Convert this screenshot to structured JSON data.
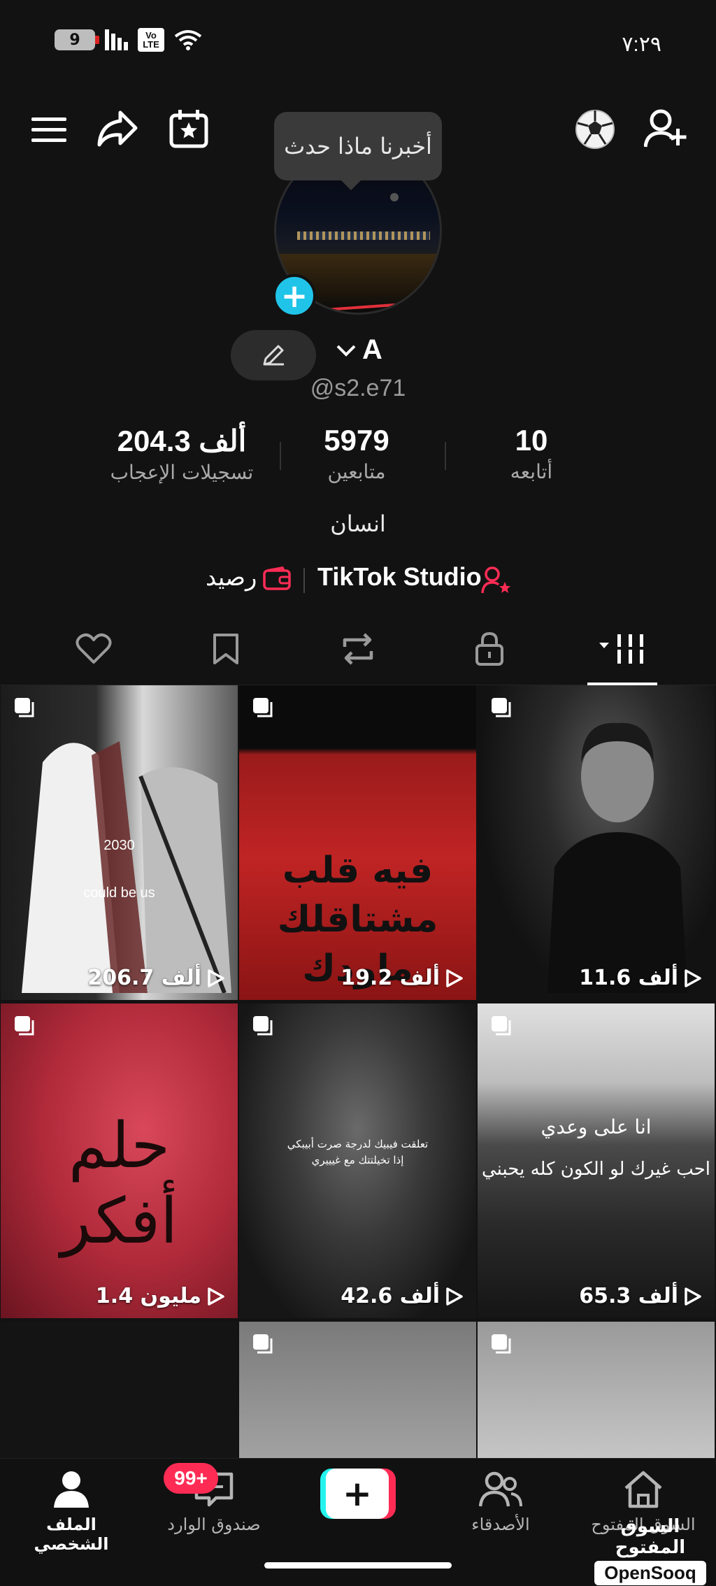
{
  "status_bar": {
    "battery_level": "9",
    "network_label": "Vo LTE",
    "time": "٧:٢٩"
  },
  "tooltip": {
    "text": "أخبرنا ماذا حدث"
  },
  "profile": {
    "display_name": "A",
    "username": "@s2.e71",
    "bio": "انسان"
  },
  "stats": {
    "following": {
      "value": "10",
      "label": "أتابعه"
    },
    "followers": {
      "value": "5979",
      "label": "متابعين"
    },
    "likes": {
      "value": "204.3 ألف",
      "label": "تسجيلات الإعجاب"
    }
  },
  "links": {
    "studio": "TikTok Studio",
    "wallet": "رصيد"
  },
  "videos": [
    {
      "views": "11.6 ألف"
    },
    {
      "views": "19.2 ألف",
      "text": "فيه قلب مشتاقلك ماودك تحره؟"
    },
    {
      "views": "206.7 ألف",
      "text1": "2030",
      "text2": "could be us"
    },
    {
      "views": "65.3 ألف",
      "text1": "انا على وعدي",
      "text2": "احب غيرك لو الكون كله يحبني"
    },
    {
      "views": "42.6 ألف",
      "text": "تعلقت فيبيك لدرجة صرت أبيبكي إذا تخيلتتك مع غيييري"
    },
    {
      "views": "1.4 مليون",
      "text": "حلم أفكر"
    },
    {
      "views": ""
    },
    {
      "views": ""
    }
  ],
  "bottom_nav": {
    "home": "السوق المفتوح",
    "friends": "الأصدقاء",
    "inbox": "صندوق الوارد",
    "inbox_badge": "99+",
    "profile": "الملف الشخصي"
  },
  "watermark": {
    "arabic": "السوق المفتوح",
    "latin": "OpenSooq"
  },
  "colors": {
    "accent_pink": "#fe2c55",
    "accent_cyan": "#25f4ee",
    "badge_blue": "#20c4e8"
  }
}
